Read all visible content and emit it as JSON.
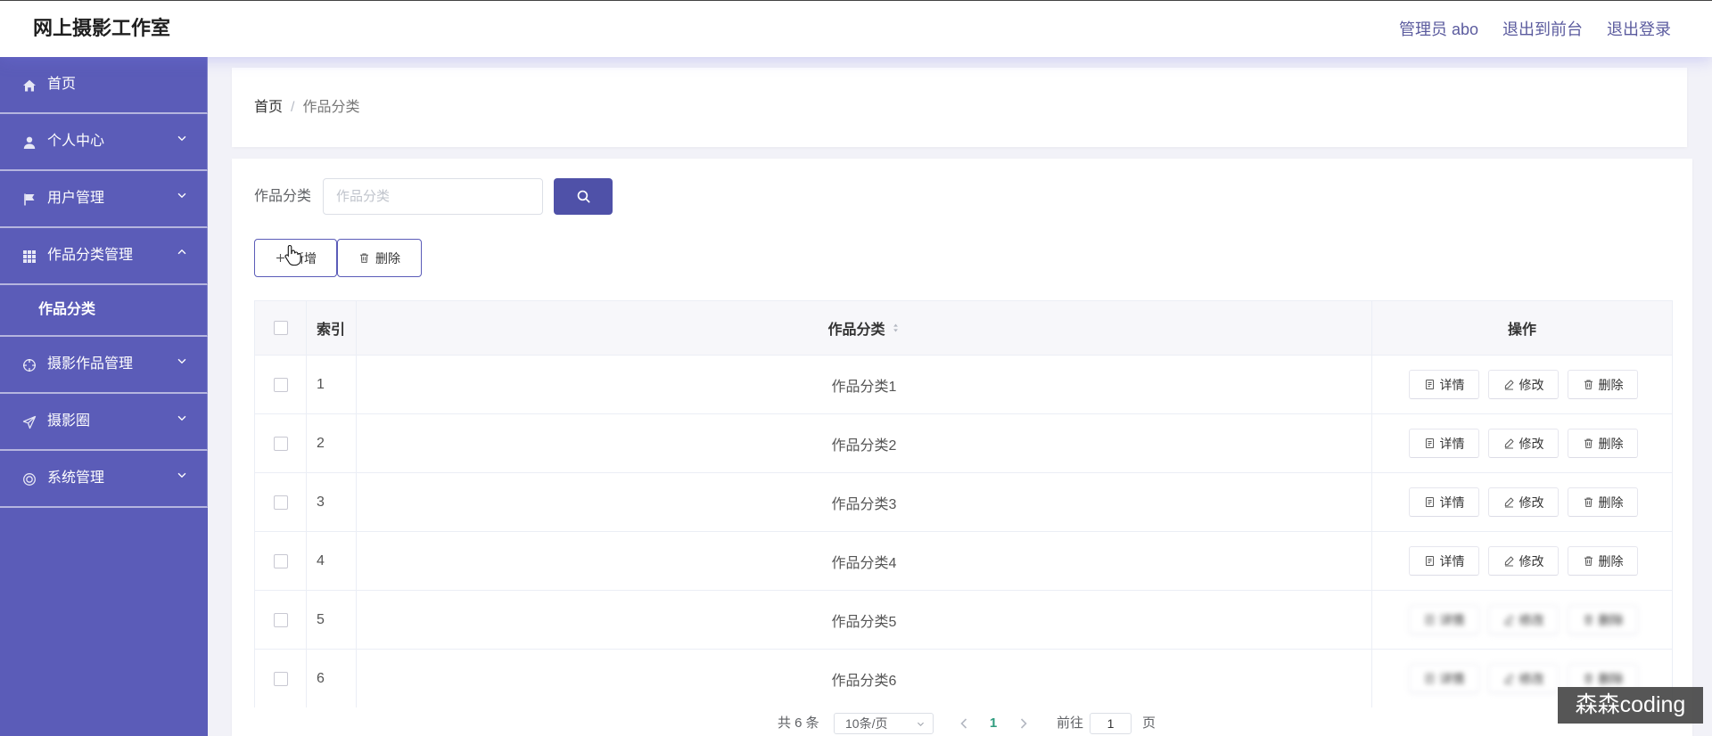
{
  "header": {
    "title": "网上摄影工作室",
    "user": "管理员 abo",
    "front_link": "退出到前台",
    "logout_link": "退出登录"
  },
  "sidebar": {
    "items": [
      {
        "label": "首页",
        "icon": "home-icon"
      },
      {
        "label": "个人中心",
        "icon": "user-icon",
        "chevron": "chevron-down-icon"
      },
      {
        "label": "用户管理",
        "icon": "flag-icon",
        "chevron": "chevron-down-icon"
      },
      {
        "label": "作品分类管理",
        "icon": "grid-icon",
        "chevron": "chevron-up-icon",
        "expanded": true,
        "children": [
          {
            "label": "作品分类"
          }
        ]
      },
      {
        "label": "摄影作品管理",
        "icon": "aim-icon",
        "chevron": "chevron-down-icon"
      },
      {
        "label": "摄影圈",
        "icon": "send-icon",
        "chevron": "chevron-down-icon"
      },
      {
        "label": "系统管理",
        "icon": "setting-icon",
        "chevron": "chevron-down-icon"
      }
    ]
  },
  "breadcrumb": {
    "home": "首页",
    "separator": "/",
    "current": "作品分类"
  },
  "search": {
    "label": "作品分类",
    "placeholder": "作品分类",
    "value": "",
    "button_icon": "search-icon"
  },
  "toolbar": {
    "add_label": "新增",
    "add_icon": "plus-icon",
    "delete_label": "删除",
    "delete_icon": "trash-icon"
  },
  "table": {
    "columns": {
      "index": "索引",
      "category": "作品分类",
      "actions": "操作"
    },
    "sort_icon": "sort-icon",
    "actions": [
      {
        "label": "详情",
        "icon": "document-icon"
      },
      {
        "label": "修改",
        "icon": "edit-icon"
      },
      {
        "label": "删除",
        "icon": "trash-icon"
      }
    ],
    "rows": [
      {
        "index": "1",
        "category": "作品分类1"
      },
      {
        "index": "2",
        "category": "作品分类2"
      },
      {
        "index": "3",
        "category": "作品分类3"
      },
      {
        "index": "4",
        "category": "作品分类4"
      },
      {
        "index": "5",
        "category": "作品分类5"
      },
      {
        "index": "6",
        "category": "作品分类6"
      }
    ]
  },
  "pagination": {
    "total": "共 6 条",
    "page_size": "10条/页",
    "current_page": "1",
    "goto_label": "前往",
    "goto_value": "1",
    "page_suffix": "页"
  },
  "watermark": "森森coding",
  "colors": {
    "sidebar": "#5b5cb8",
    "primary_button": "#4f51a8",
    "header_link": "#5b5b9e",
    "page_background": "#f2f2f8",
    "active_page": "#2f9c7e"
  }
}
